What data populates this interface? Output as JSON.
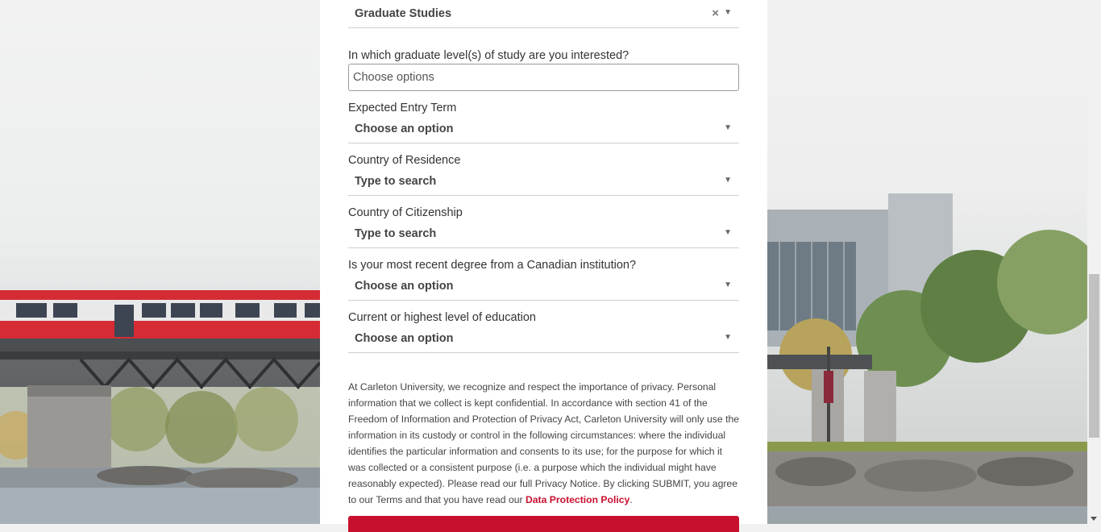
{
  "form": {
    "program_select": {
      "value": "Graduate Studies",
      "clear_icon": "×",
      "arrow_icon": "▼"
    },
    "grad_level": {
      "label": "In which graduate level(s) of study are you interested?",
      "placeholder": "Choose options"
    },
    "entry_term": {
      "label": "Expected Entry Term",
      "value": "Choose an option",
      "arrow_icon": "▼"
    },
    "residence": {
      "label": "Country of Residence",
      "value": "Type to search",
      "arrow_icon": "▼"
    },
    "citizenship": {
      "label": "Country of Citizenship",
      "value": "Type to search",
      "arrow_icon": "▼"
    },
    "canadian_degree": {
      "label": "Is your most recent degree from a Canadian institution?",
      "value": "Choose an option",
      "arrow_icon": "▼"
    },
    "education_level": {
      "label": "Current or highest level of education",
      "value": "Choose an option",
      "arrow_icon": "▼"
    }
  },
  "privacy": {
    "text": "At Carleton University, we recognize and respect the importance of privacy. Personal information that we collect is kept confidential. In accordance with section 41 of the Freedom of Information and Protection of Privacy Act, Carleton University will only use the information in its custody or control in the following circumstances: where the individual identifies the particular information and consents to its use; for the purpose for which it was collected or a consistent purpose (i.e. a purpose which the individual might have reasonably expected). Please read our full Privacy Notice. By clicking SUBMIT, you agree to our Terms and that you have read our ",
    "link_text": "Data Protection Policy",
    "end": "."
  },
  "colors": {
    "accent": "#c8102e",
    "panel": "#ffffff",
    "page_bg": "#f1f1f1"
  }
}
